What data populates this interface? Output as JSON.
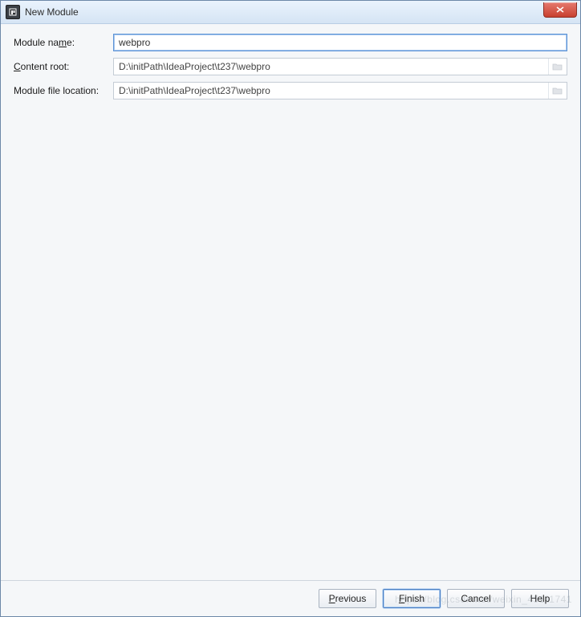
{
  "window": {
    "title": "New Module"
  },
  "form": {
    "module_name": {
      "label_pre": "Module na",
      "label_ul": "m",
      "label_post": "e:",
      "value": "webpro"
    },
    "content_root": {
      "label_pre": "",
      "label_ul": "C",
      "label_post": "ontent root:",
      "value": "D:\\initPath\\IdeaProject\\t237\\webpro"
    },
    "module_file_location": {
      "label": "Module file location:",
      "value": "D:\\initPath\\IdeaProject\\t237\\webpro"
    }
  },
  "buttons": {
    "previous": {
      "ul": "P",
      "rest": "revious"
    },
    "finish": {
      "ul": "F",
      "rest": "inish"
    },
    "cancel": {
      "text": "Cancel"
    },
    "help": {
      "text": "Help"
    }
  },
  "watermark": "https://blog.csdn.net/weixin_45111741"
}
